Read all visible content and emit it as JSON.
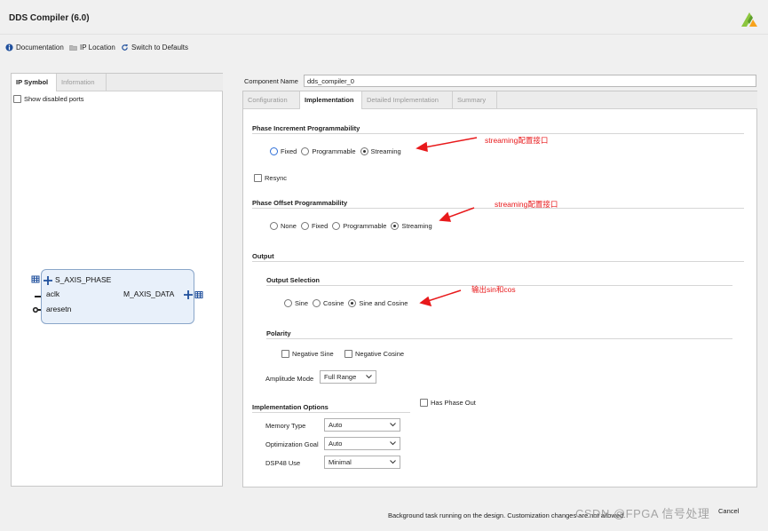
{
  "app": {
    "title": "DDS Compiler (6.0)"
  },
  "toolbar": {
    "documentation": "Documentation",
    "ip_location": "IP Location",
    "switch_defaults": "Switch to Defaults"
  },
  "left": {
    "tabs": [
      "IP Symbol",
      "Information"
    ],
    "show_disabled_ports": "Show disabled ports",
    "ports": {
      "s_axis_phase": "S_AXIS_PHASE",
      "aclk": "aclk",
      "aresetn": "aresetn",
      "m_axis_data": "M_AXIS_DATA"
    }
  },
  "right": {
    "component_name_label": "Component Name",
    "component_name_value": "dds_compiler_0",
    "tabs": [
      "Configuration",
      "Implementation",
      "Detailed Implementation",
      "Summary"
    ],
    "phase_increment": {
      "title": "Phase Increment Programmability",
      "options": [
        "Fixed",
        "Programmable",
        "Streaming"
      ],
      "selected": "Streaming"
    },
    "resync_label": "Resync",
    "phase_offset": {
      "title": "Phase Offset Programmability",
      "options": [
        "None",
        "Fixed",
        "Programmable",
        "Streaming"
      ],
      "selected": "Streaming"
    },
    "output": {
      "title": "Output",
      "selection_title": "Output Selection",
      "selection_options": [
        "Sine",
        "Cosine",
        "Sine and Cosine"
      ],
      "selected": "Sine and Cosine",
      "polarity_title": "Polarity",
      "negative_sine": "Negative Sine",
      "negative_cosine": "Negative Cosine",
      "amplitude_label": "Amplitude Mode",
      "amplitude_value": "Full Range"
    },
    "impl_options": {
      "title": "Implementation Options",
      "has_phase_out": "Has Phase Out",
      "memory_type_label": "Memory Type",
      "memory_type_value": "Auto",
      "opt_goal_label": "Optimization Goal",
      "opt_goal_value": "Auto",
      "dsp48_label": "DSP48 Use",
      "dsp48_value": "Minimal"
    }
  },
  "annotations": {
    "a1": "streaming配置接口",
    "a2": "streaming配置接口",
    "a3": "输出sin和cos"
  },
  "status": "Background task running on the design. Customization changes are not allowed.",
  "watermark": "CSDN @FPGA 信号处理",
  "cancel": "Cancel",
  "colors": {
    "annotation": "#e8191b",
    "accent": "#2f6fd8",
    "block_fill": "#e8f0fa"
  }
}
